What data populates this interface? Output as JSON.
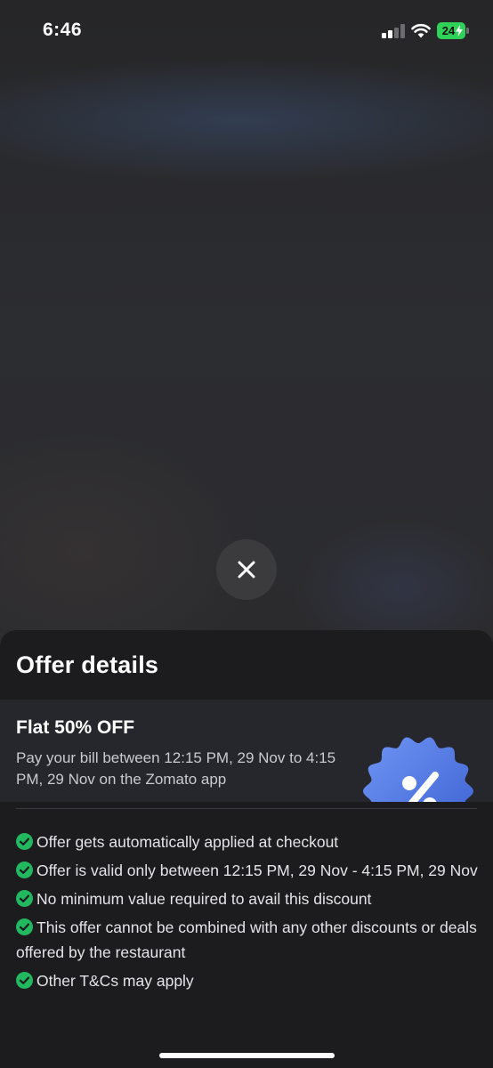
{
  "status_bar": {
    "time": "6:46",
    "battery": "24",
    "battery_color": "#30d158"
  },
  "close_button": {
    "icon": "close-icon"
  },
  "sheet": {
    "title": "Offer details",
    "offer": {
      "heading": "Flat 50% OFF",
      "description": "Pay your bill between 12:15 PM, 29 Nov to 4:15 PM, 29 Nov on the Zomato app",
      "badge_icon": "percent-badge-icon",
      "badge_color": "#4a72e0"
    },
    "terms": [
      "Offer gets automatically applied at checkout",
      "Offer is valid only between 12:15 PM, 29 Nov - 4:15 PM, 29 Nov",
      "No minimum value required to avail this discount",
      "This offer cannot be combined with any other discounts or deals offered by the restaurant",
      "Other T&Cs may apply"
    ],
    "check_color": "#22b860"
  }
}
